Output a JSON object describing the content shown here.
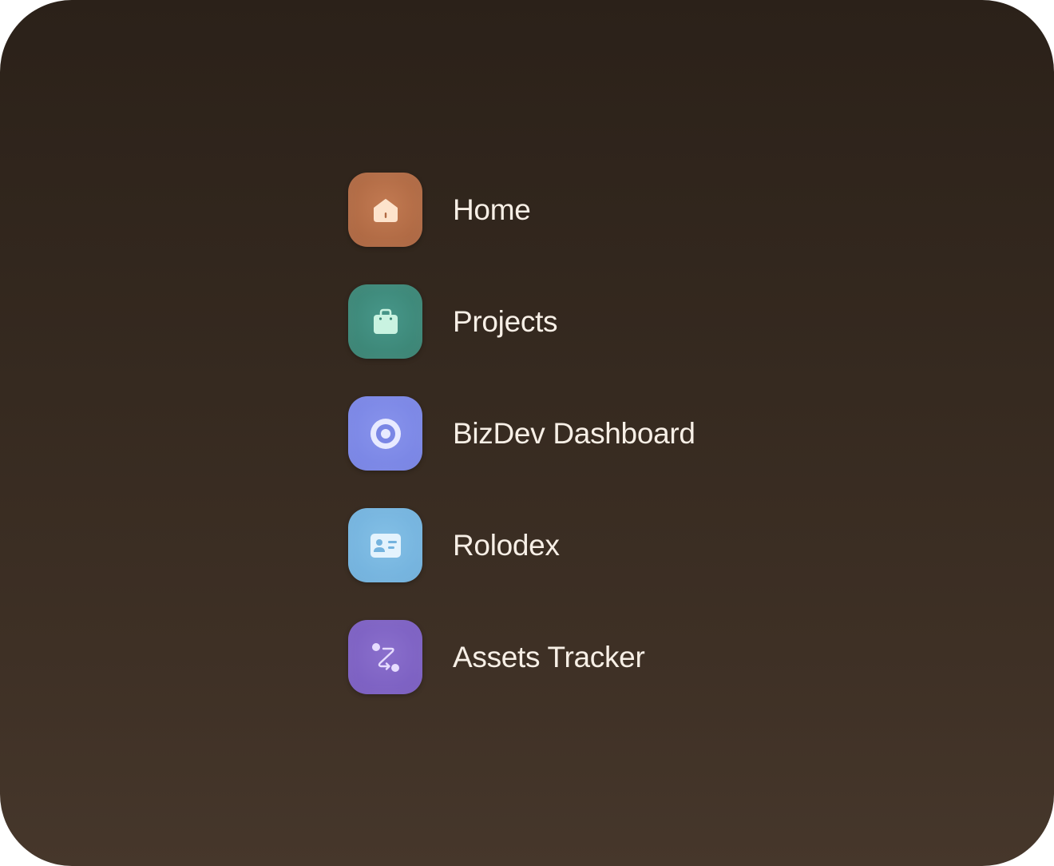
{
  "nav": {
    "items": [
      {
        "label": "Home",
        "icon": "home-icon",
        "color": "#b56e48"
      },
      {
        "label": "Projects",
        "icon": "briefcase-icon",
        "color": "#3f8b7b"
      },
      {
        "label": "BizDev Dashboard",
        "icon": "target-icon",
        "color": "#7b87e6"
      },
      {
        "label": "Rolodex",
        "icon": "contact-card-icon",
        "color": "#74b4df"
      },
      {
        "label": "Assets Tracker",
        "icon": "route-icon",
        "color": "#7e62c4"
      }
    ]
  }
}
